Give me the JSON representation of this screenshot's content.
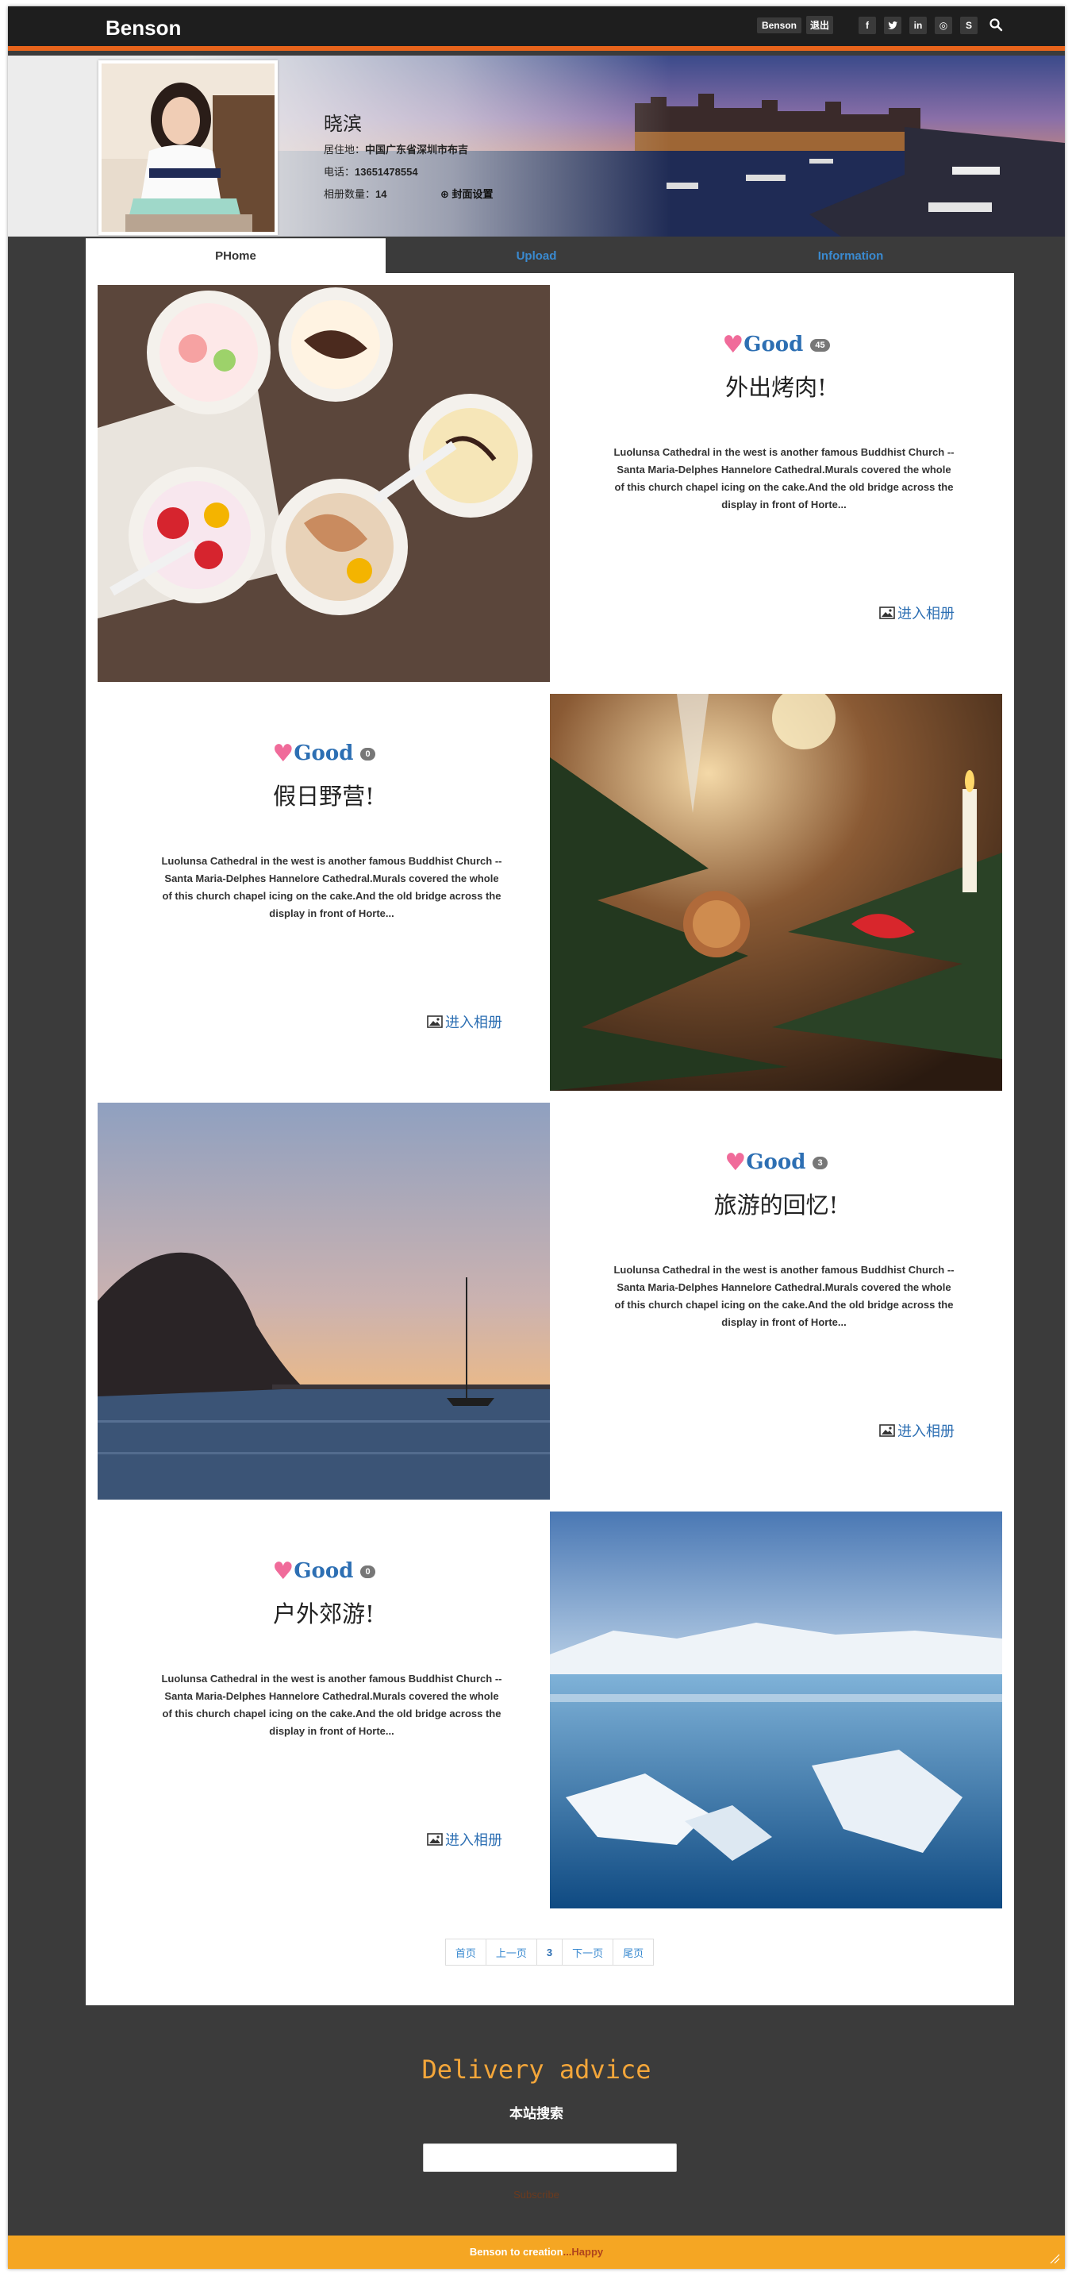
{
  "header": {
    "brand": "Benson",
    "user": "Benson",
    "logout": "退出",
    "social": [
      {
        "icon": "facebook-icon",
        "glyph": "f"
      },
      {
        "icon": "twitter-icon",
        "glyph": "t"
      },
      {
        "icon": "linkedin-icon",
        "glyph": "in"
      },
      {
        "icon": "dribbble-icon",
        "glyph": "◎"
      },
      {
        "icon": "skype-icon",
        "glyph": "S"
      }
    ],
    "search_icon": "search-icon",
    "accent": "#e8641b"
  },
  "profile": {
    "name": "晓滨",
    "residence_label": "居住地：",
    "residence": "中国广东省深圳市布吉",
    "phone_label": "电话：",
    "phone": "13651478554",
    "albums_label": "相册数量：",
    "albums": "14",
    "cover_settings": "封面设置"
  },
  "tabs": [
    {
      "label": "PHome",
      "active": true
    },
    {
      "label": "Upload",
      "active": false
    },
    {
      "label": "Information",
      "active": false
    }
  ],
  "posts": [
    {
      "good": "Good",
      "count": "45",
      "title": "外出烤肉!",
      "desc": "Luolunsa Cathedral in the west is another famous Buddhist Church -- Santa Maria-Delphes Hannelore Cathedral.Murals covered the whole of this church chapel icing on the cake.And the old bridge across the display in front of Horte...",
      "link": "进入相册",
      "image": "frozen-yogurt-photo"
    },
    {
      "good": "Good",
      "count": "0",
      "title": "假日野营!",
      "desc": "Luolunsa Cathedral in the west is another famous Buddhist Church -- Santa Maria-Delphes Hannelore Cathedral.Murals covered the whole of this church chapel icing on the cake.And the old bridge across the display in front of Horte...",
      "link": "进入相册",
      "image": "christmas-tree-photo"
    },
    {
      "good": "Good",
      "count": "3",
      "title": "旅游的回忆!",
      "desc": "Luolunsa Cathedral in the west is another famous Buddhist Church -- Santa Maria-Delphes Hannelore Cathedral.Murals covered the whole of this church chapel icing on the cake.And the old bridge across the display in front of Horte...",
      "link": "进入相册",
      "image": "sunset-sailboat-photo"
    },
    {
      "good": "Good",
      "count": "0",
      "title": "户外郊游!",
      "desc": "Luolunsa Cathedral in the west is another famous Buddhist Church -- Santa Maria-Delphes Hannelore Cathedral.Murals covered the whole of this church chapel icing on the cake.And the old bridge across the display in front of Horte...",
      "link": "进入相册",
      "image": "icebergs-photo"
    }
  ],
  "pagination": {
    "first": "首页",
    "prev": "上一页",
    "current": "3",
    "next": "下一页",
    "last": "尾页"
  },
  "footer": {
    "delivery_title": "Delivery advice",
    "site_search": "本站搜索",
    "subscribe": "Subscribe",
    "credit": "Benson to creation",
    "credit_suffix": "...Happy",
    "bar_color": "#f5a623"
  }
}
